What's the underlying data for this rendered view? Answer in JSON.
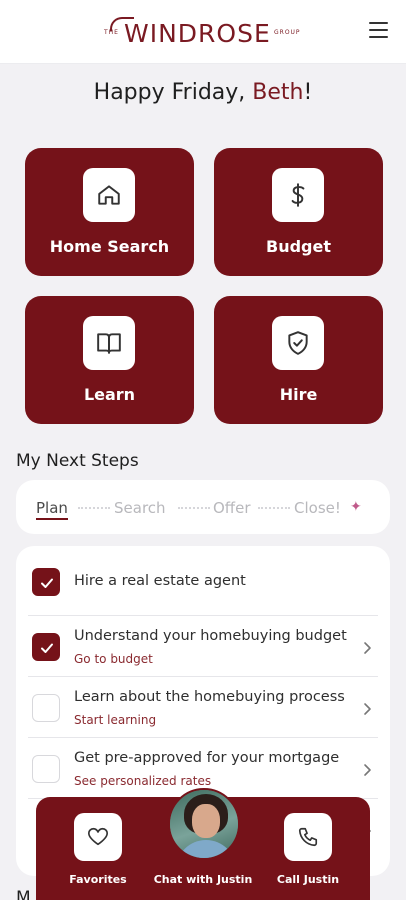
{
  "header": {
    "logo_text_the": "THE",
    "logo_text_name": "WINDROSE",
    "logo_text_group": "GROUP",
    "menu_icon": "hamburger-menu-icon"
  },
  "greeting": {
    "prefix": "Happy Friday, ",
    "name": "Beth",
    "suffix": "!"
  },
  "tiles": [
    {
      "label": "Home Search",
      "icon": "house-icon"
    },
    {
      "label": "Budget",
      "icon": "dollar-icon"
    },
    {
      "label": "Learn",
      "icon": "book-icon"
    },
    {
      "label": "Hire",
      "icon": "shield-check-icon"
    }
  ],
  "next_steps": {
    "title": "My Next Steps",
    "stages": [
      "Plan",
      "Search",
      "Offer",
      "Close!"
    ],
    "active_stage": "Plan",
    "items": [
      {
        "title": "Hire a real estate agent",
        "link": "",
        "checked": true
      },
      {
        "title": "Understand your homebuying budget",
        "link": "Go to budget",
        "checked": true
      },
      {
        "title": "Learn about the homebuying process",
        "link": "Start learning",
        "checked": false
      },
      {
        "title": "Get pre-approved for your mortgage",
        "link": "See personalized rates",
        "checked": false
      }
    ]
  },
  "bottom_bar": {
    "favorites": "Favorites",
    "chat": "Chat with Justin",
    "call": "Call Justin"
  },
  "colors": {
    "brand": "#751219",
    "background": "#f2f1f4",
    "card": "#ffffff"
  }
}
